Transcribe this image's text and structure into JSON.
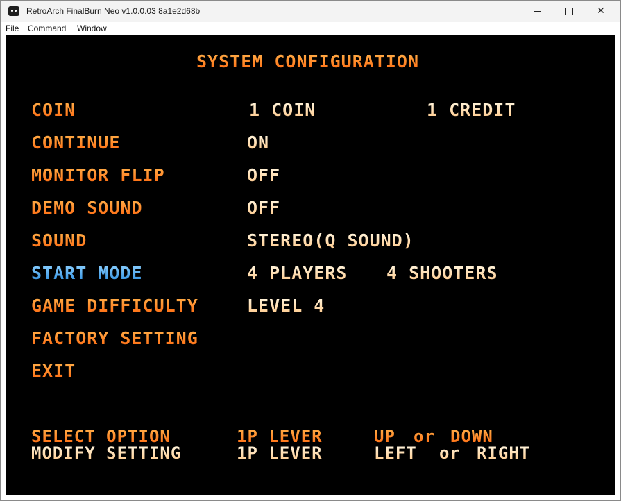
{
  "window": {
    "title": "RetroArch FinalBurn Neo v1.0.0.03  8a1e2d68b",
    "controls": {
      "minimize": "minimize",
      "maximize": "maximize",
      "close": "✕"
    }
  },
  "menubar": {
    "items": [
      "File",
      "Command",
      "Window"
    ]
  },
  "game": {
    "heading": "SYSTEM CONFIGURATION",
    "options": [
      {
        "label": "COIN",
        "value": "1 COIN",
        "value2": "1 CREDIT"
      },
      {
        "label": "CONTINUE",
        "value": "ON"
      },
      {
        "label": "MONITOR FLIP",
        "value": "OFF"
      },
      {
        "label": "DEMO SOUND",
        "value": "OFF"
      },
      {
        "label": "SOUND",
        "value": "STEREO(Q SOUND)"
      },
      {
        "label": "START MODE",
        "value": "4 PLAYERS",
        "value2": "4 SHOOTERS",
        "selected": true
      },
      {
        "label": "GAME DIFFICULTY",
        "value": "LEVEL 4"
      },
      {
        "label": "FACTORY SETTING"
      },
      {
        "label": "EXIT"
      }
    ],
    "help": [
      {
        "action": "SELECT OPTION",
        "control": "1P LEVER",
        "dir1": "UP",
        "or": "or",
        "dir2": "DOWN"
      },
      {
        "action": "MODIFY SETTING",
        "control": "1P LEVER",
        "dir1": "LEFT",
        "or": "or",
        "dir2": "RIGHT"
      }
    ],
    "colors": {
      "label": "#ff7a1a",
      "value": "#ffe2b0",
      "selected": "#48a8f0",
      "background": "#000000"
    }
  }
}
